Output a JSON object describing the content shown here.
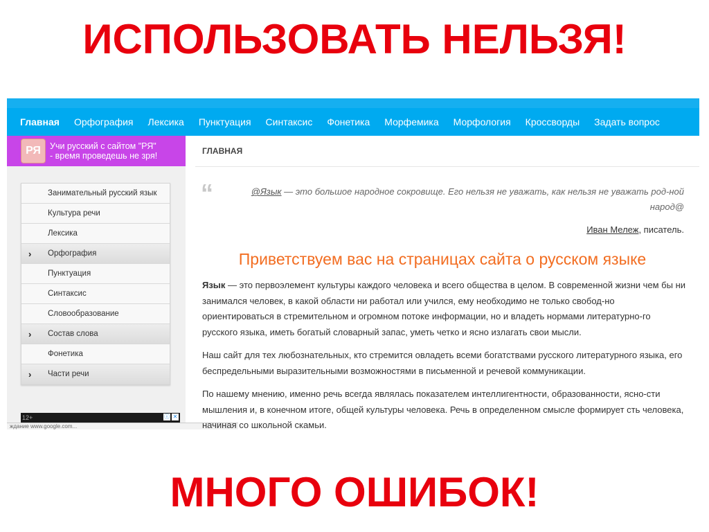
{
  "slide": {
    "top_title": "ИСПОЛЬЗОВАТЬ НЕЛЬЗЯ!",
    "bottom_title": "МНОГО ОШИБОК!",
    "title_color": "#e8000d"
  },
  "nav": {
    "items": [
      "Главная",
      "Орфография",
      "Лексика",
      "Пунктуация",
      "Синтаксис",
      "Фонетика",
      "Морфемика",
      "Морфология",
      "Кроссворды",
      "Задать вопрос"
    ],
    "active_index": 0,
    "color": "#00aaf0"
  },
  "banner": {
    "logo": "РЯ",
    "line1": "Учи русский с сайтом \"РЯ\"",
    "line2": "- время проведешь не зря!",
    "color": "#c845e8"
  },
  "sidebar": {
    "items": [
      {
        "label": "Занимательный русский язык",
        "has_sub": false
      },
      {
        "label": "Культура речи",
        "has_sub": false
      },
      {
        "label": "Лексика",
        "has_sub": false
      },
      {
        "label": "Орфография",
        "has_sub": true
      },
      {
        "label": "Пунктуация",
        "has_sub": false
      },
      {
        "label": "Синтаксис",
        "has_sub": false
      },
      {
        "label": "Словообразование",
        "has_sub": false
      },
      {
        "label": "Состав слова",
        "has_sub": true
      },
      {
        "label": "Фонетика",
        "has_sub": false
      },
      {
        "label": "Части речи",
        "has_sub": true
      }
    ],
    "chevron": "›"
  },
  "ad": {
    "age": "12+",
    "info_icon": "ⓘ",
    "close_icon": "✕",
    "status": "ждание www.google.com..."
  },
  "main": {
    "breadcrumb": "ГЛАВНАЯ",
    "quote_mark": "“",
    "quote_link": "@Язык",
    "quote_text": " — это большое народное сокровище. Его нельзя не уважать, как нельзя не уважать род-ной народ@",
    "author_link": "Иван Мележ",
    "author_rest": ", писатель.",
    "welcome": "Приветствуем вас на страницах сайта о русском языке",
    "p1_bold": "Язык",
    "p1": " — это первоэлемент культуры каждого человека и всего общества в целом. В современной жизни чем бы ни занимался человек, в какой области ни работал или учился, ему необходимо не только свобод-но ориентироваться в стремительном и огромном потоке информации, но и владеть нормами литературно-го русского языка, иметь богатый словарный запас, уметь четко и ясно излагать свои мысли.",
    "p2": "Наш сайт для тех любознательных, кто стремится овладеть всеми богатствами русского литературного языка, его беспредельными выразительными возможностями в письменной и речевой коммуникации.",
    "p3": "По нашему мнению, именно речь всегда являлась показателем интеллигентности, образованности, ясно-сти мышления и, в конечном итоге, общей культуры человека. Речь в определенном смысле формирует сть человека, начиная со школьной скамьи."
  }
}
